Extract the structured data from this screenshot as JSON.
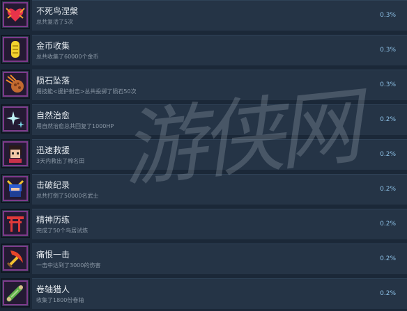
{
  "achievements": [
    {
      "title": "不死鸟涅槃",
      "desc": "总共复活了5次",
      "percent": "0.3%",
      "icon": "phoenix-heart-icon"
    },
    {
      "title": "金币收集",
      "desc": "总共收集了60000个金币",
      "percent": "0.3%",
      "icon": "gold-coin-icon"
    },
    {
      "title": "陨石坠落",
      "desc": "用技能<援护射击>总共投掷了陨石50次",
      "percent": "0.3%",
      "icon": "meteor-icon"
    },
    {
      "title": "自然治愈",
      "desc": "用自然治愈总共回复了1000HP",
      "percent": "0.2%",
      "icon": "sparkle-heal-icon"
    },
    {
      "title": "迅速救援",
      "desc": "3天内救出了棉名田",
      "percent": "0.2%",
      "icon": "rescued-girl-icon"
    },
    {
      "title": "击破纪录",
      "desc": "总共打倒了50000名武士",
      "percent": "0.2%",
      "icon": "samurai-helmet-icon"
    },
    {
      "title": "精神历练",
      "desc": "完成了50个鸟居试炼",
      "percent": "0.2%",
      "icon": "torii-gate-icon"
    },
    {
      "title": "痛恨一击",
      "desc": "一击中达到了3000的伤害",
      "percent": "0.2%",
      "icon": "flaming-sword-icon"
    },
    {
      "title": "卷轴猎人",
      "desc": "收集了1800份卷轴",
      "percent": "0.2%",
      "icon": "scroll-icon"
    }
  ],
  "watermark": "游侠网",
  "colors": {
    "background": "#1b2838",
    "panel": "#253446",
    "percent": "#8ec2e8",
    "frame": "#7d3a8a"
  }
}
